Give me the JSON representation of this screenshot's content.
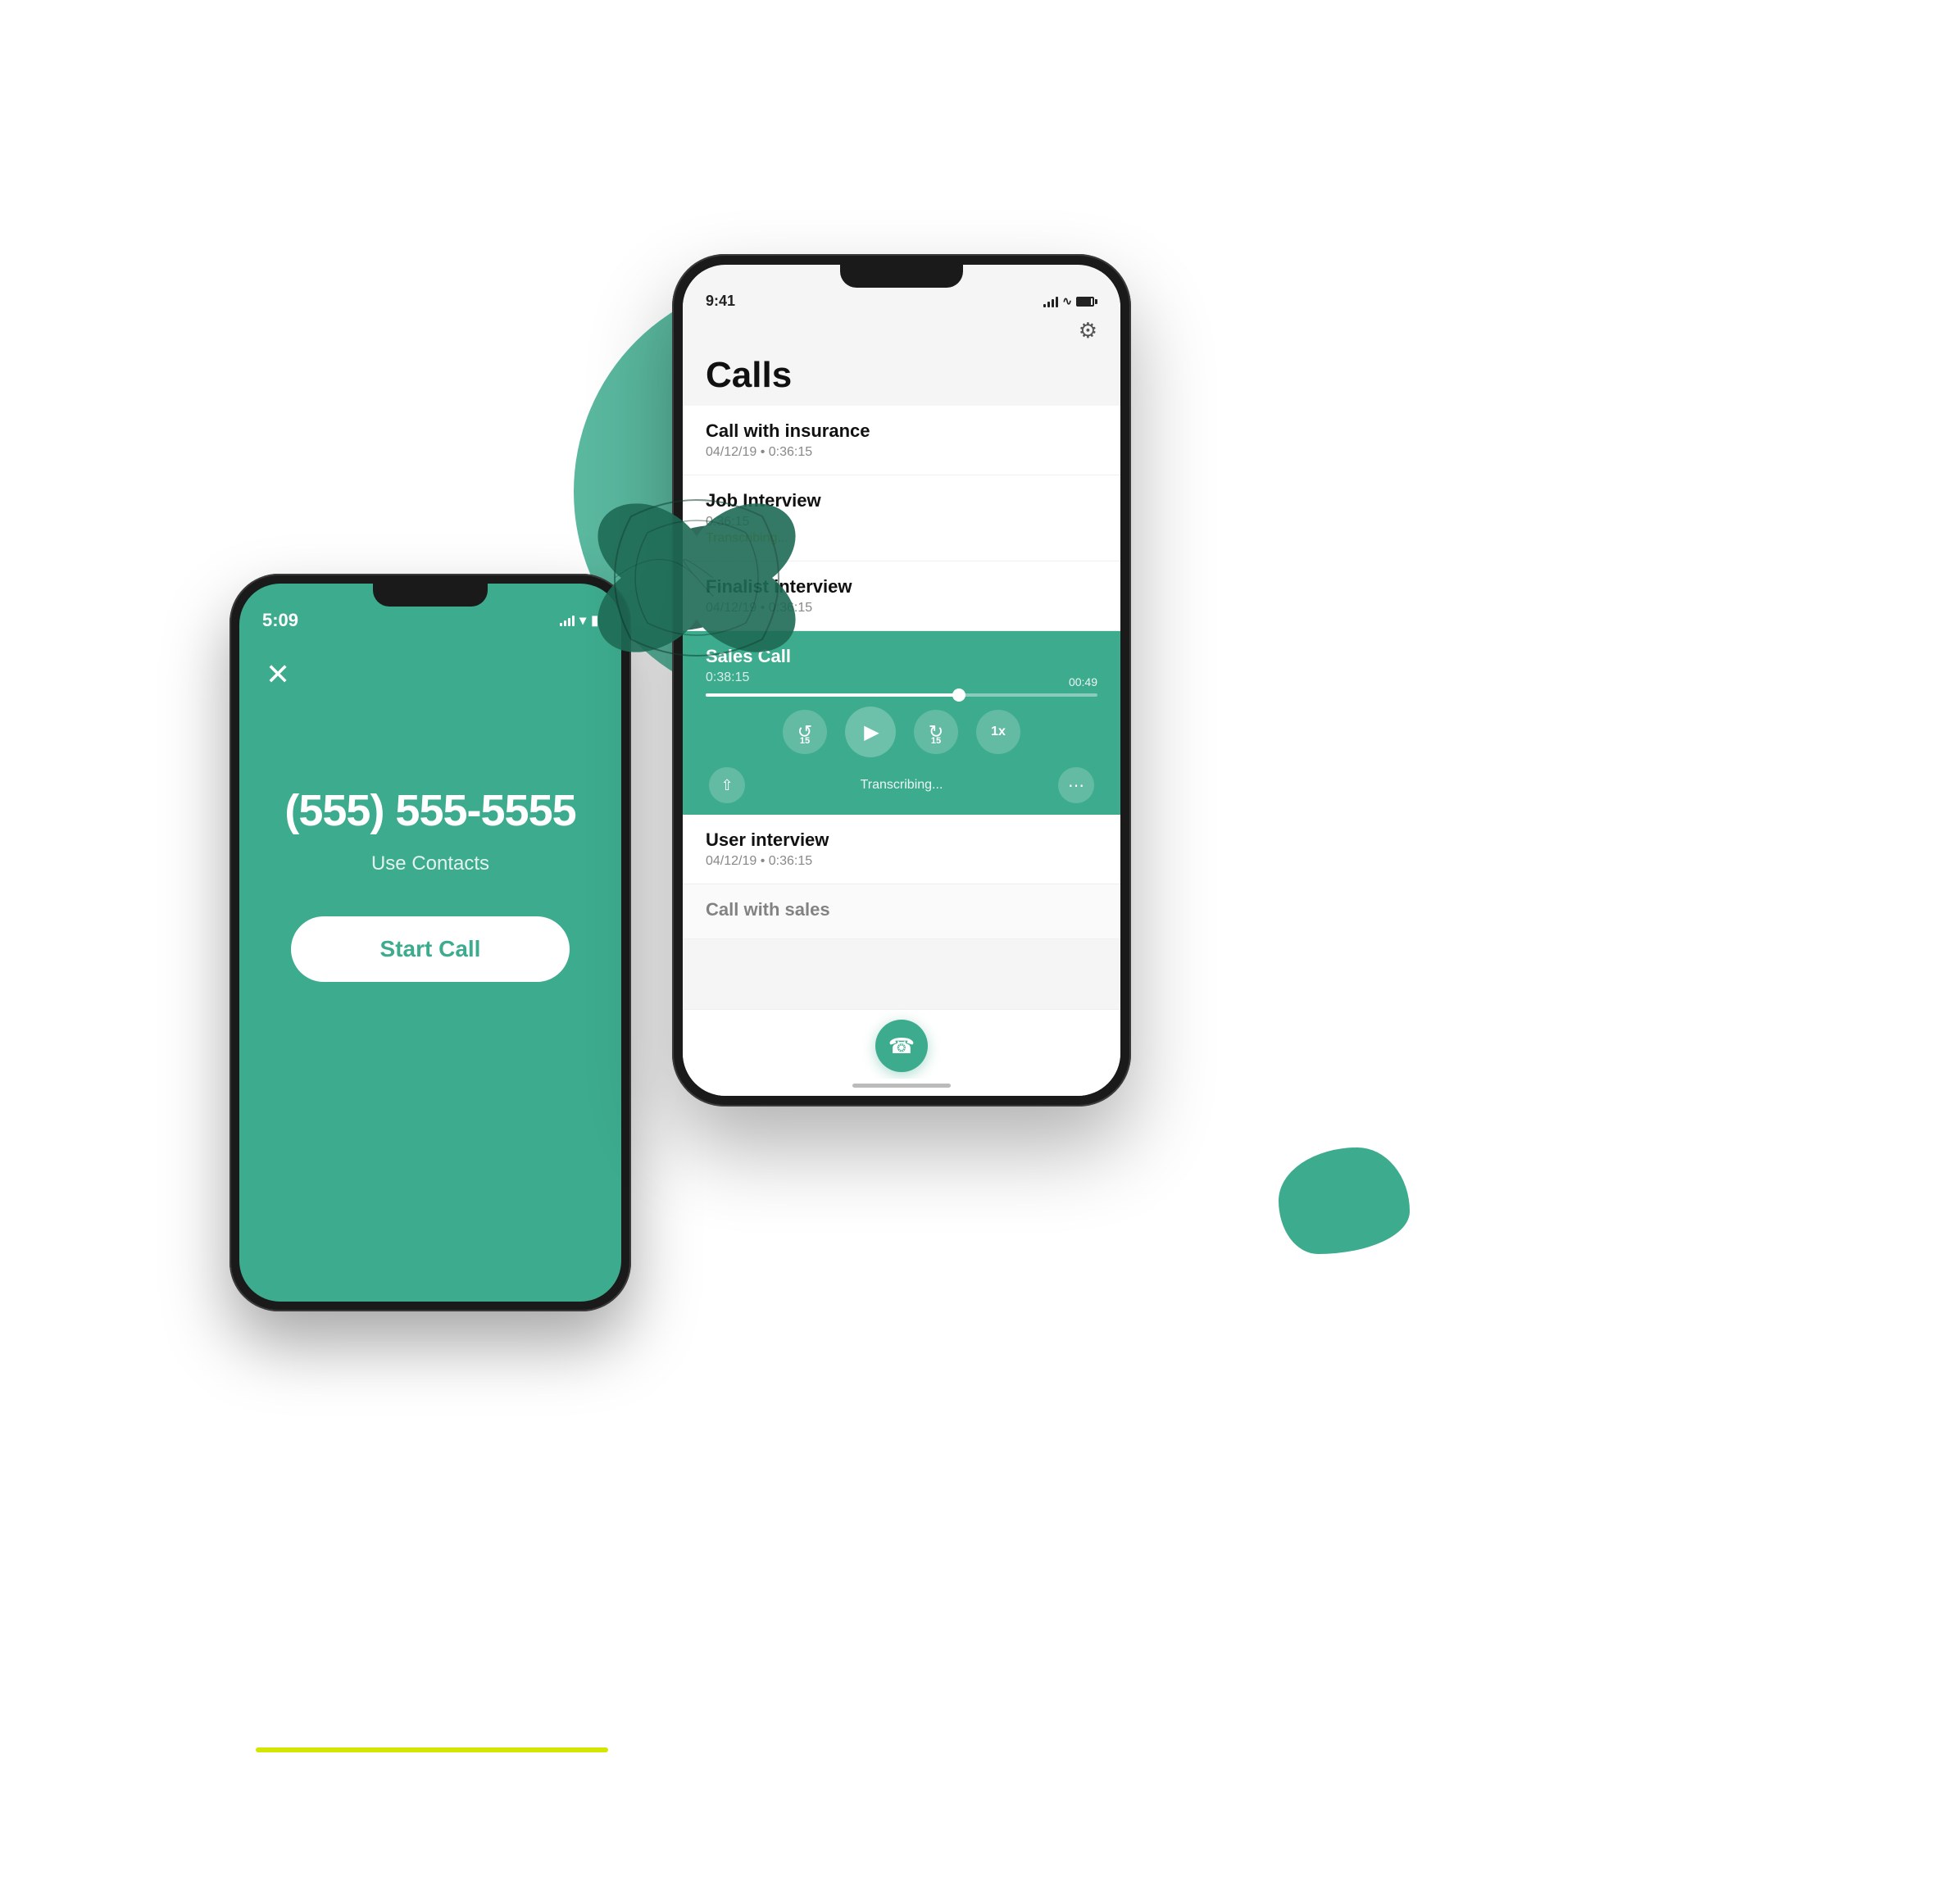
{
  "scene": {
    "bg_circle": {
      "desc": "decorative green circle"
    },
    "blob_small": {
      "desc": "small green blob bottom right"
    }
  },
  "phone_left": {
    "status_time": "5:09",
    "close_icon": "✕",
    "phone_number": "(555) 555-5555",
    "use_contacts": "Use Contacts",
    "start_call_btn": "Start Call"
  },
  "phone_right": {
    "status_time": "9:41",
    "screen_title": "Calls",
    "gear_icon": "⚙",
    "calls": [
      {
        "name": "Call with insurance",
        "date": "04/12/19",
        "duration": "0:36:15",
        "status": "",
        "active": false
      },
      {
        "name": "Job Interview",
        "date": "",
        "duration": "0:36:15",
        "status": "Transcribing...",
        "active": false
      },
      {
        "name": "Finalist interview",
        "date": "04/12/19",
        "duration": "0:36:15",
        "status": "",
        "active": false
      },
      {
        "name": "Sales Call",
        "date": "",
        "duration": "0:38:15",
        "status": "",
        "active": true,
        "player": {
          "progress_pct": 65,
          "time_elapsed": "00:49",
          "speed": "1x"
        }
      },
      {
        "name": "User interview",
        "date": "04/12/19",
        "duration": "0:36:15",
        "status": "",
        "active": false
      },
      {
        "name": "Call with sales",
        "date": "",
        "duration": "",
        "status": "",
        "active": false
      }
    ],
    "transcribing_label": "Transcribing...",
    "fab_icon": "☎",
    "rewind_label": "15",
    "forward_label": "15",
    "speed_label": "1x"
  }
}
